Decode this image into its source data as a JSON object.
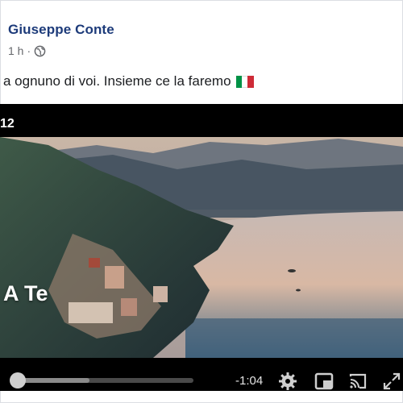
{
  "post": {
    "author": "Giuseppe Conte",
    "timestamp": "1 h",
    "separator": "·",
    "privacy_icon": "globe-icon",
    "text": "a ognuno di voi. Insieme ce la faremo",
    "flag_colors": [
      "#009246",
      "#ffffff",
      "#ce2b37"
    ]
  },
  "video": {
    "top_label": "12",
    "overlay_text": "A Te",
    "time_remaining": "-1:04",
    "progress_fraction": 0.0,
    "buffered_fraction": 0.42,
    "icons": [
      "settings-gear-icon",
      "picture-in-picture-icon",
      "cast-icon",
      "fullscreen-icon"
    ]
  },
  "colors": {
    "author": "#1d3b7a",
    "meta": "#65676b",
    "video_bg": "#000000"
  }
}
